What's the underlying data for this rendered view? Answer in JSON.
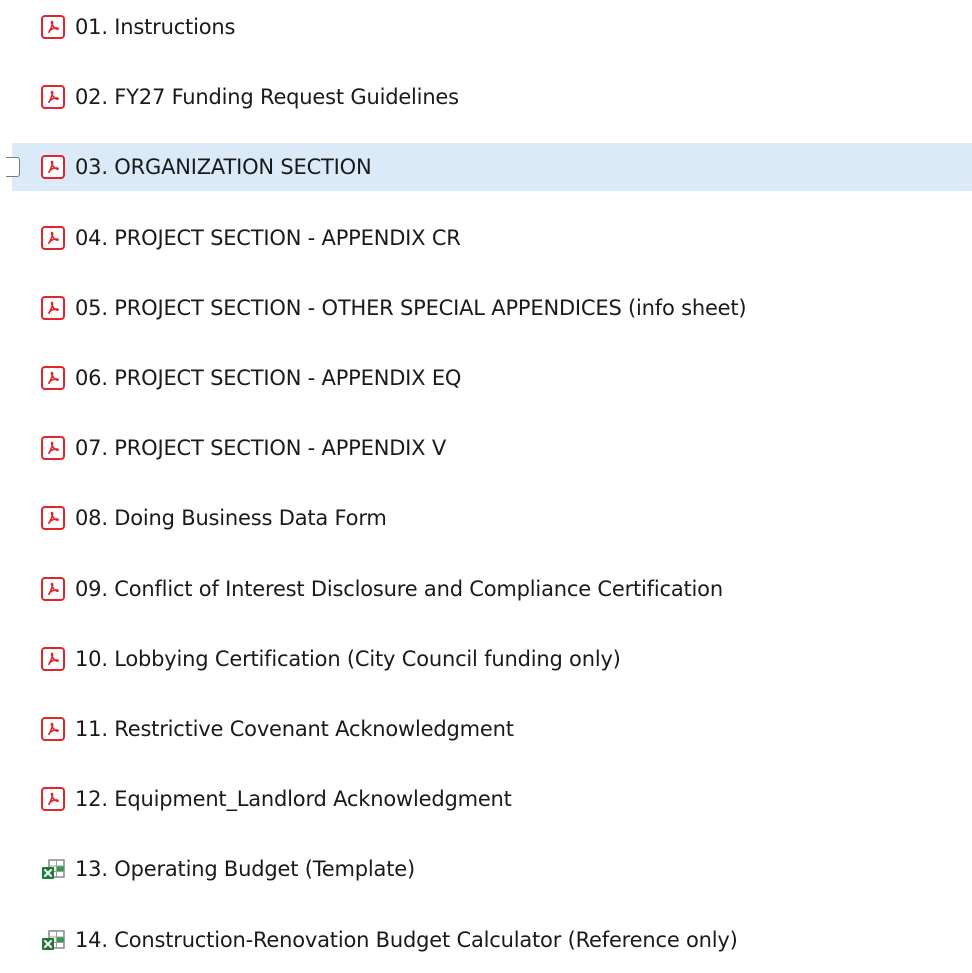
{
  "files": [
    {
      "name": "01. Instructions",
      "type": "pdf",
      "selected": false
    },
    {
      "name": "02. FY27 Funding Request Guidelines",
      "type": "pdf",
      "selected": false
    },
    {
      "name": "03. ORGANIZATION SECTION",
      "type": "pdf",
      "selected": true
    },
    {
      "name": "04. PROJECT SECTION - APPENDIX CR",
      "type": "pdf",
      "selected": false
    },
    {
      "name": "05. PROJECT SECTION - OTHER SPECIAL APPENDICES (info sheet)",
      "type": "pdf",
      "selected": false
    },
    {
      "name": "06. PROJECT SECTION - APPENDIX EQ",
      "type": "pdf",
      "selected": false
    },
    {
      "name": "07. PROJECT SECTION - APPENDIX V",
      "type": "pdf",
      "selected": false
    },
    {
      "name": "08. Doing Business Data Form",
      "type": "pdf",
      "selected": false
    },
    {
      "name": "09. Conflict of Interest Disclosure and Compliance Certification",
      "type": "pdf",
      "selected": false
    },
    {
      "name": "10. Lobbying Certification (City Council funding only)",
      "type": "pdf",
      "selected": false
    },
    {
      "name": "11. Restrictive Covenant Acknowledgment",
      "type": "pdf",
      "selected": false
    },
    {
      "name": "12. Equipment_Landlord Acknowledgment",
      "type": "pdf",
      "selected": false
    },
    {
      "name": "13. Operating Budget (Template)",
      "type": "excel",
      "selected": false
    },
    {
      "name": "14. Construction-Renovation Budget Calculator (Reference only)",
      "type": "excel",
      "selected": false
    }
  ],
  "icons": {
    "pdf": "pdf-file-icon",
    "excel": "excel-file-icon"
  },
  "colors": {
    "pdf_red": "#e3242b",
    "excel_green": "#1d7a3a",
    "selection": "#dbeaf8"
  }
}
